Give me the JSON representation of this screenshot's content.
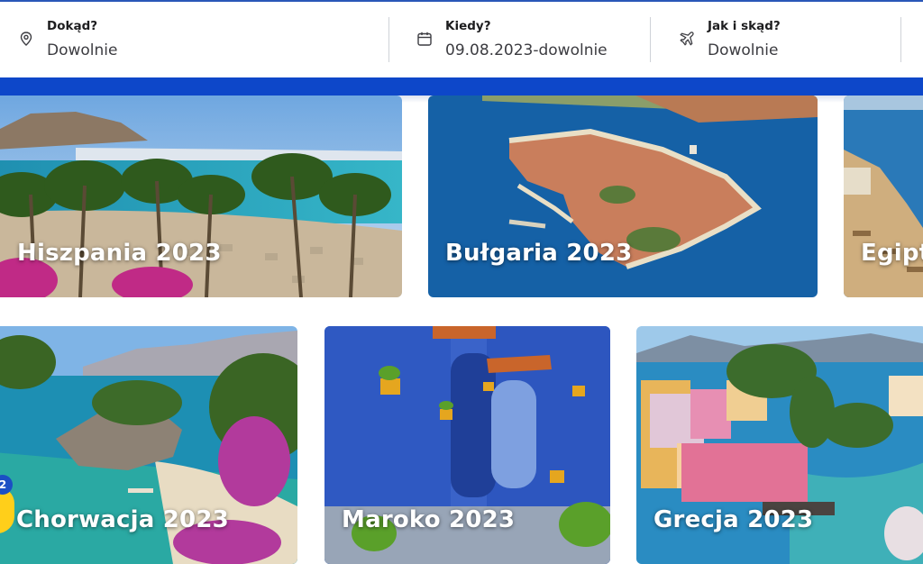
{
  "search": {
    "destination": {
      "label": "Dokąd?",
      "value": "Dowolnie",
      "icon": "map-pin-icon"
    },
    "when": {
      "label": "Kiedy?",
      "value": "09.08.2023-dowolnie",
      "icon": "calendar-icon"
    },
    "how": {
      "label": "Jak i skąd?",
      "value": "Dowolnie",
      "icon": "plane-icon"
    }
  },
  "destinations": [
    {
      "title": "Hiszpania 2023"
    },
    {
      "title": "Bułgaria 2023"
    },
    {
      "title": "Egipt"
    },
    {
      "title": "Chorwacja 2023"
    },
    {
      "title": "Maroko 2023"
    },
    {
      "title": "Grecja 2023"
    }
  ],
  "badge": {
    "count": "2"
  },
  "colors": {
    "accent": "#0d47c9",
    "badge": "#1b4fc4",
    "chat": "#ffcf1a"
  }
}
